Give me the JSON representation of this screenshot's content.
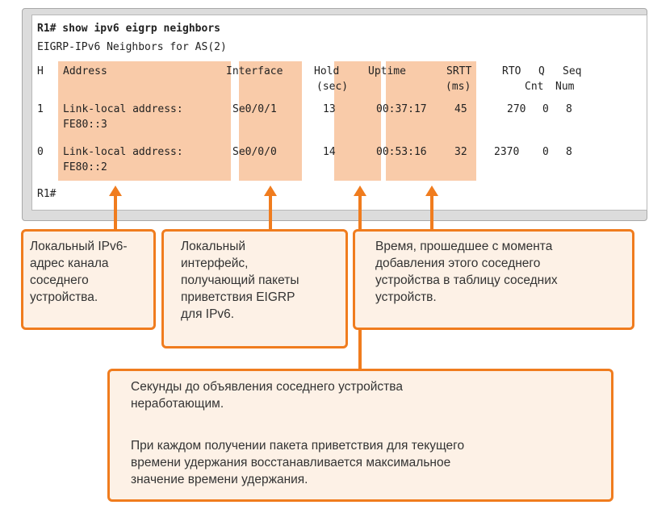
{
  "terminal": {
    "command": "R1# show ipv6 eigrp neighbors",
    "title_line": "EIGRP-IPv6 Neighbors for AS(2)",
    "headers": {
      "h": "H",
      "address": "Address",
      "interface": "Interface",
      "hold": "Hold",
      "hold_unit": "(sec)",
      "uptime": "Uptime",
      "srtt": "SRTT",
      "srtt_unit": "(ms)",
      "rto": "RTO",
      "q": "Q",
      "q_sub": "Cnt",
      "seq": "Seq",
      "seq_sub": "Num"
    },
    "rows": [
      {
        "h": "1",
        "address": "Link-local address:",
        "address_cont": "FE80::3",
        "interface": "Se0/0/1",
        "hold": "13",
        "uptime": "00:37:17",
        "srtt": "45",
        "rto": "270",
        "q": "0",
        "seq": "8"
      },
      {
        "h": "0",
        "address": "Link-local address:",
        "address_cont": "FE80::2",
        "interface": "Se0/0/0",
        "hold": "14",
        "uptime": "00:53:16",
        "srtt": "32",
        "rto": "2370",
        "q": "0",
        "seq": "8"
      }
    ],
    "prompt": "R1#"
  },
  "callouts": {
    "address": "Локальный IPv6-\nадрес канала\nсоседнего\nустройства.",
    "interface": "Локальный\nинтерфейс,\nполучающий пакеты\nприветствия EIGRP\nдля IPv6.",
    "uptime": "Время, прошедшее с момента\nдобавления этого соседнего\nустройства в таблицу соседних\nустройств.",
    "hold_p1": "Секунды до объявления соседнего устройства\nнеработающим.",
    "hold_p2": "При каждом получении пакета приветствия для текущего\nвремени удержания восстанавливается максимальное\nзначение времени удержания."
  },
  "colors": {
    "accent": "#f07c1e",
    "highlight": "#f9cba9",
    "callout_fill": "#fdf1e6"
  }
}
